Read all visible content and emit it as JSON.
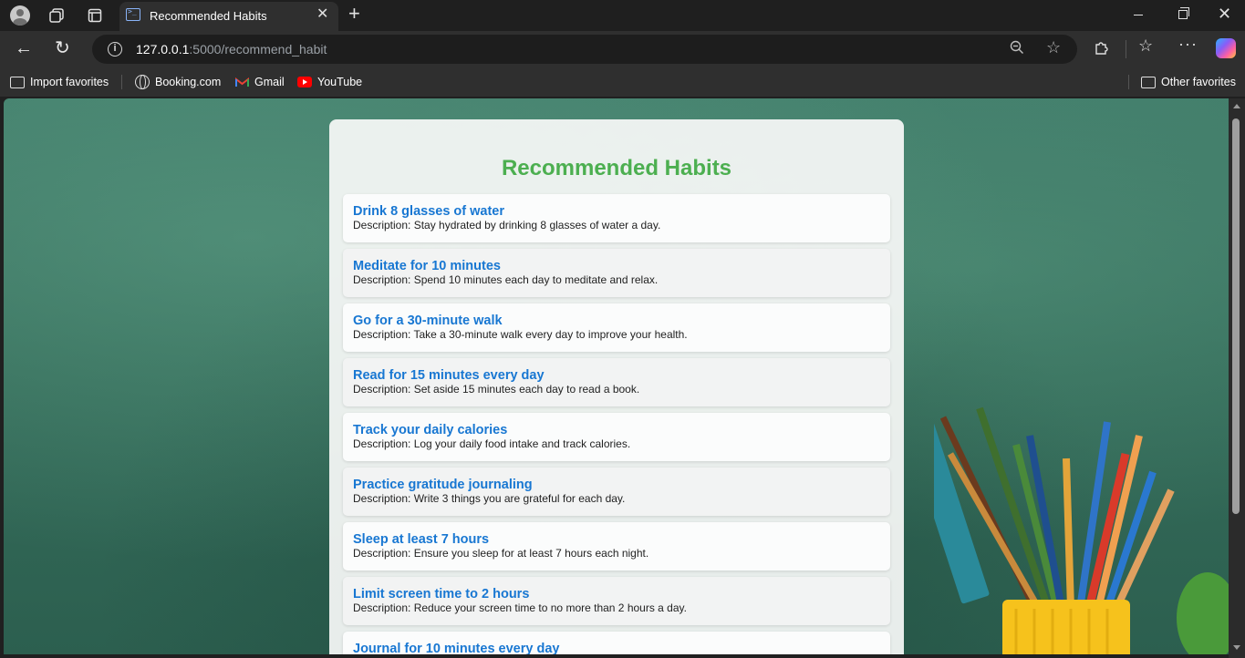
{
  "browser": {
    "tab_title": "Recommended Habits",
    "url_host": "127.0.0.1",
    "url_rest": ":5000/recommend_habit",
    "favorites": {
      "import": "Import favorites",
      "booking": "Booking.com",
      "gmail": "Gmail",
      "youtube": "YouTube",
      "other": "Other favorites"
    }
  },
  "page": {
    "title": "Recommended Habits",
    "habits": [
      {
        "name": "Drink 8 glasses of water",
        "description": "Description: Stay hydrated by drinking 8 glasses of water a day."
      },
      {
        "name": "Meditate for 10 minutes",
        "description": "Description: Spend 10 minutes each day to meditate and relax."
      },
      {
        "name": "Go for a 30-minute walk",
        "description": "Description: Take a 30-minute walk every day to improve your health."
      },
      {
        "name": "Read for 15 minutes every day",
        "description": "Description: Set aside 15 minutes each day to read a book."
      },
      {
        "name": "Track your daily calories",
        "description": "Description: Log your daily food intake and track calories."
      },
      {
        "name": "Practice gratitude journaling",
        "description": "Description: Write 3 things you are grateful for each day."
      },
      {
        "name": "Sleep at least 7 hours",
        "description": "Description: Ensure you sleep for at least 7 hours each night."
      },
      {
        "name": "Limit screen time to 2 hours",
        "description": "Description: Reduce your screen time to no more than 2 hours a day."
      },
      {
        "name": "Journal for 10 minutes every day",
        "description": ""
      }
    ]
  },
  "colors": {
    "title_green": "#4caf50",
    "habit_blue": "#1877d2",
    "chalkboard": "#356d5b"
  }
}
